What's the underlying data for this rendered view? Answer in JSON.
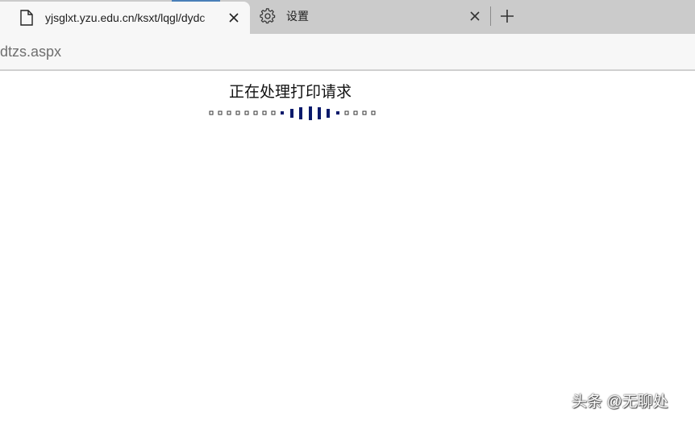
{
  "browser": {
    "tabs": [
      {
        "title": "yjsglxt.yzu.edu.cn/ksxt/lqgl/dydc",
        "icon": "document-icon",
        "active": true
      },
      {
        "title": "设置",
        "icon": "gear-icon",
        "active": false
      }
    ],
    "address_bar": {
      "url_fragment": "dtzs.aspx"
    }
  },
  "page": {
    "status_text": "正在处理打印请求"
  },
  "watermark": {
    "text": "头条 @无聊处"
  },
  "colors": {
    "tabstrip": "#cbcbcb",
    "active_tab": "#f7f7f7",
    "progress_bar": "#0a1a6b"
  }
}
